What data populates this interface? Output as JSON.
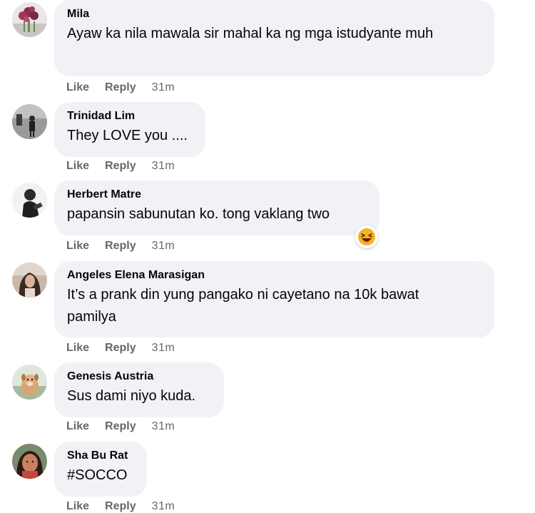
{
  "comments": [
    {
      "author": "Mila",
      "text": "Ayaw ka nila mawala sir mahal ka ng mga istudyante muh",
      "like": "Like",
      "reply": "Reply",
      "time": "31m"
    },
    {
      "author": "Trinidad Lim",
      "text": "They LOVE you ....",
      "like": "Like",
      "reply": "Reply",
      "time": "31m"
    },
    {
      "author": "Herbert Matre",
      "text": "papansin sabunutan ko. tong vaklang two",
      "like": "Like",
      "reply": "Reply",
      "time": "31m",
      "reaction_icon": "laughing-emoji-icon"
    },
    {
      "author": "Angeles Elena Marasigan",
      "text": "It’s a prank din yung pangako ni cayetano na 10k bawat pamilya",
      "like": "Like",
      "reply": "Reply",
      "time": "31m"
    },
    {
      "author": "Genesis Austria",
      "text": "Sus dami niyo kuda.",
      "like": "Like",
      "reply": "Reply",
      "time": "31m"
    },
    {
      "author": "Sha Bu Rat",
      "text": "#SOCCO",
      "like": "Like",
      "reply": "Reply",
      "time": "31m"
    }
  ],
  "colors": {
    "bubble_bg": "#f0f2f5",
    "text": "#050505",
    "meta": "#65676b"
  }
}
